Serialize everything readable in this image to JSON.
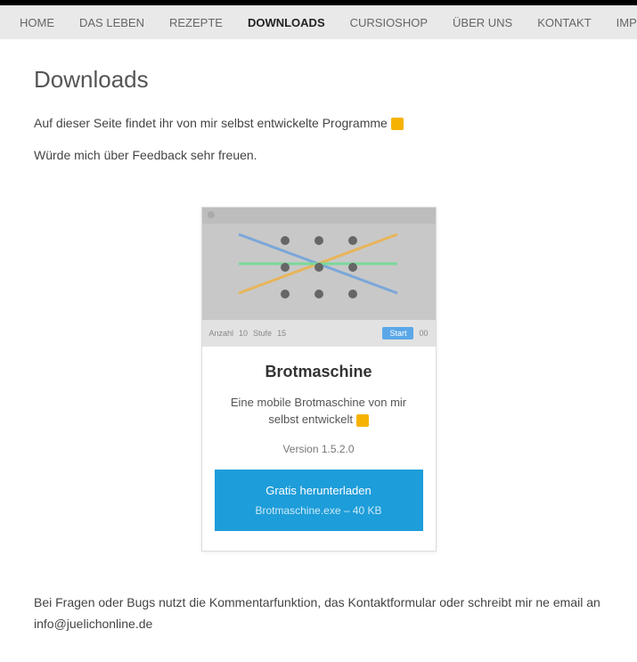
{
  "nav": {
    "items": [
      {
        "label": "HOME"
      },
      {
        "label": "DAS LEBEN"
      },
      {
        "label": "REZEPTE"
      },
      {
        "label": "DOWNLOADS",
        "active": true
      },
      {
        "label": "CURSIOSHOP"
      },
      {
        "label": "ÜBER UNS"
      },
      {
        "label": "KONTAKT"
      },
      {
        "label": "IMPRE"
      }
    ]
  },
  "page": {
    "title": "Downloads",
    "intro1": "Auf dieser Seite findet ihr von mir selbst entwickelte Programme ",
    "intro2": "Würde mich über Feedback sehr freuen.",
    "footer": "Bei Fragen oder Bugs nutzt die Kommentarfunktion, das Kontaktformular oder schreibt mir ne email an info@juelichonline.de"
  },
  "card": {
    "title": "Brotmaschine",
    "desc": "Eine mobile Brotmaschine von mir selbst entwickelt ",
    "version": "Version 1.5.2.0",
    "btn_line1": "Gratis herunterladen",
    "btn_line2": "Brotmaschine.exe – 40 KB",
    "thumb_labels": {
      "a": "Anzahl",
      "b": "Stufe",
      "start": "Start"
    }
  }
}
